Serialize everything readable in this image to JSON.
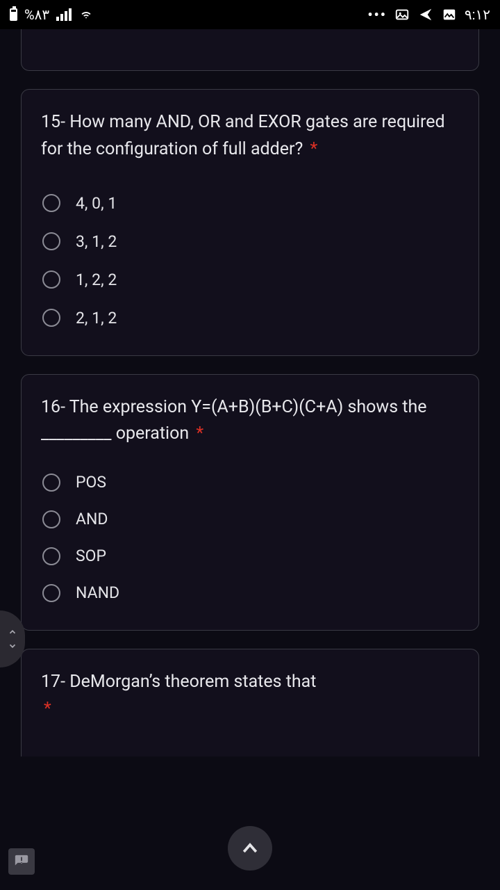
{
  "status": {
    "battery_text": "%۸۳",
    "clock": "۹:۱۲"
  },
  "questions": [
    {
      "text": "15- How many AND, OR and EXOR gates are required for the configuration of full adder?",
      "required_mark": "*",
      "options": [
        "4, 0, 1",
        "3, 1, 2",
        "1, 2, 2",
        "2, 1, 2"
      ]
    },
    {
      "text": "16- The expression Y=(A+B)(B+C)(C+A) shows the _________ operation",
      "required_mark": "*",
      "options": [
        "POS",
        "AND",
        "SOP",
        "NAND"
      ]
    },
    {
      "text": "17- DeMorgan’s theorem states that",
      "required_mark": "*",
      "options": []
    }
  ]
}
